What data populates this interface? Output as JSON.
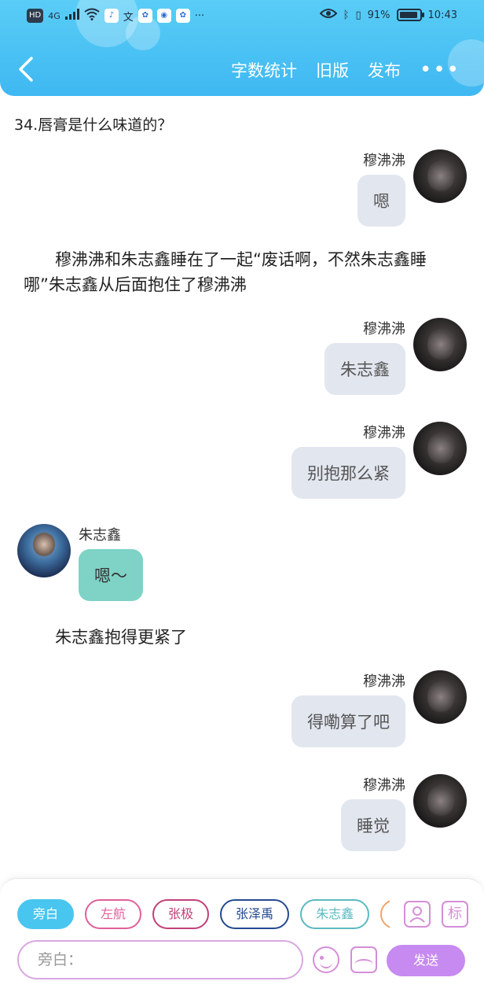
{
  "status_bar": {
    "left_hd": "HD",
    "left_network": "4G",
    "left_wifi_icon": "wifi-icon",
    "left_text_glyph": "文",
    "left_more": "···",
    "battery_percent": "91%",
    "time": "10:43"
  },
  "header": {
    "actions": [
      "字数统计",
      "旧版",
      "发布"
    ],
    "more_label": "•••"
  },
  "topic": "34.唇膏是什么味道的？",
  "colors": {
    "header": "#48c6ef",
    "gray_bubble": "#e2e6ef",
    "teal_bubble": "#7ed3c6",
    "accent_purple": "#c68af0"
  },
  "messages": [
    {
      "side": "right",
      "name": "穆沸沸",
      "text": "嗯"
    },
    {
      "side": "narration",
      "text": "穆沸沸和朱志鑫睡在了一起“废话啊，不然朱志鑫睡哪”朱志鑫从后面抱住了穆沸沸"
    },
    {
      "side": "right",
      "name": "穆沸沸",
      "text": "朱志鑫"
    },
    {
      "side": "right",
      "name": "穆沸沸",
      "text": "别抱那么紧"
    },
    {
      "side": "left",
      "name": "朱志鑫",
      "text": "嗯～"
    },
    {
      "side": "narration",
      "text": "朱志鑫抱得更紧了"
    },
    {
      "side": "right",
      "name": "穆沸沸",
      "text": "得嘞算了吧"
    },
    {
      "side": "right",
      "name": "穆沸沸",
      "text": "睡觉"
    }
  ],
  "composer": {
    "roles": [
      {
        "label": "旁白",
        "color": "#48c6ef",
        "active": true
      },
      {
        "label": "左航",
        "color": "#e0609a",
        "active": false
      },
      {
        "label": "张极",
        "color": "#c2407a",
        "active": false
      },
      {
        "label": "张泽禹",
        "color": "#244a8f",
        "active": false
      },
      {
        "label": "朱志鑫",
        "color": "#5bb9c2",
        "active": false
      },
      {
        "label": "",
        "color": "#f2a36b",
        "active": false
      }
    ],
    "tool_role_icon": "person-card-icon",
    "tool_tag_label": "标",
    "input_placeholder": "旁白：",
    "send_label": "发送"
  }
}
